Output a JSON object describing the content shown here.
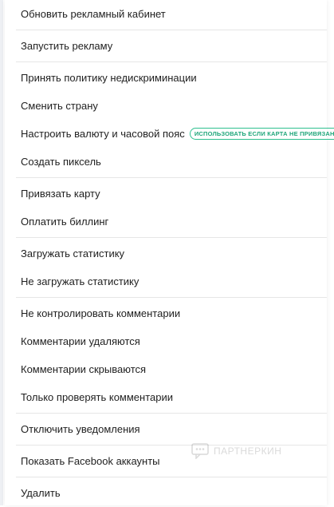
{
  "menu": {
    "items": [
      {
        "label": "Обновить рекламный кабинет"
      },
      {
        "label": "Запустить рекламу"
      },
      {
        "label": "Принять политику недискриминации"
      },
      {
        "label": "Сменить страну"
      },
      {
        "label": "Настроить валюту и часовой пояс",
        "badge": "ИСПОЛЬЗОВАТЬ ЕСЛИ КАРТА НЕ ПРИВЯЗАНА"
      },
      {
        "label": "Создать пиксель"
      },
      {
        "label": "Привязать карту"
      },
      {
        "label": "Оплатить биллинг"
      },
      {
        "label": "Загружать статистику"
      },
      {
        "label": "Не загружать статистику"
      },
      {
        "label": "Не контролировать комментарии"
      },
      {
        "label": "Комментарии удаляются"
      },
      {
        "label": "Комментарии скрываются"
      },
      {
        "label": "Только проверять комментарии"
      },
      {
        "label": "Отключить уведомления"
      },
      {
        "label": "Показать Facebook аккаунты"
      },
      {
        "label": "Удалить"
      }
    ]
  },
  "watermark": {
    "text": "ПАРТНЕРКИН"
  },
  "colors": {
    "badge": "#2ebf8f",
    "text": "#1f1f1f",
    "divider": "#e6e6e6"
  }
}
